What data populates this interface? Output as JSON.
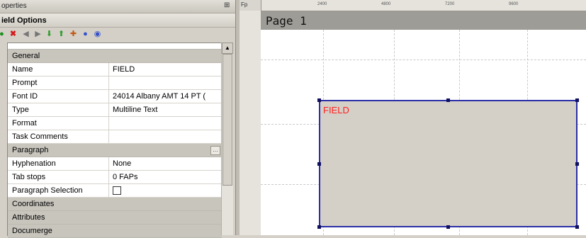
{
  "panel": {
    "title": "operties",
    "section": "ield Options"
  },
  "toolbar": {
    "icons": [
      "refresh-icon",
      "delete-icon",
      "prev-icon",
      "next-icon",
      "move-down-icon",
      "move-up-icon",
      "accept-icon",
      "info-icon",
      "help-icon"
    ]
  },
  "rows": {
    "general": "General",
    "name": {
      "label": "Name",
      "value": "FIELD"
    },
    "prompt": {
      "label": "Prompt",
      "value": ""
    },
    "fontid": {
      "label": "Font ID",
      "value": "24014 Albany AMT 14 PT ("
    },
    "type": {
      "label": "Type",
      "value": "Multiline Text"
    },
    "format": {
      "label": "Format",
      "value": ""
    },
    "task": {
      "label": "Task Comments",
      "value": ""
    },
    "paragraph": "Paragraph",
    "hyphenation": {
      "label": "Hyphenation",
      "value": "None"
    },
    "tabstops": {
      "label": "Tab stops",
      "value": "0 FAPs"
    },
    "parasel": {
      "label": "Paragraph Selection",
      "value": "unchecked"
    },
    "coordinates": "Coordinates",
    "attributes": "Attributes",
    "documerge": "Documerge"
  },
  "editor": {
    "ruler_corner": "Fp",
    "ruler_ticks": [
      "2400",
      "4800",
      "7200",
      "9600"
    ],
    "page_label": "Page 1",
    "field_text": "FIELD"
  },
  "colors": {
    "field_border": "#2b2ea6",
    "field_text": "#ff1f1f",
    "field_fill": "#d4d0c8"
  }
}
